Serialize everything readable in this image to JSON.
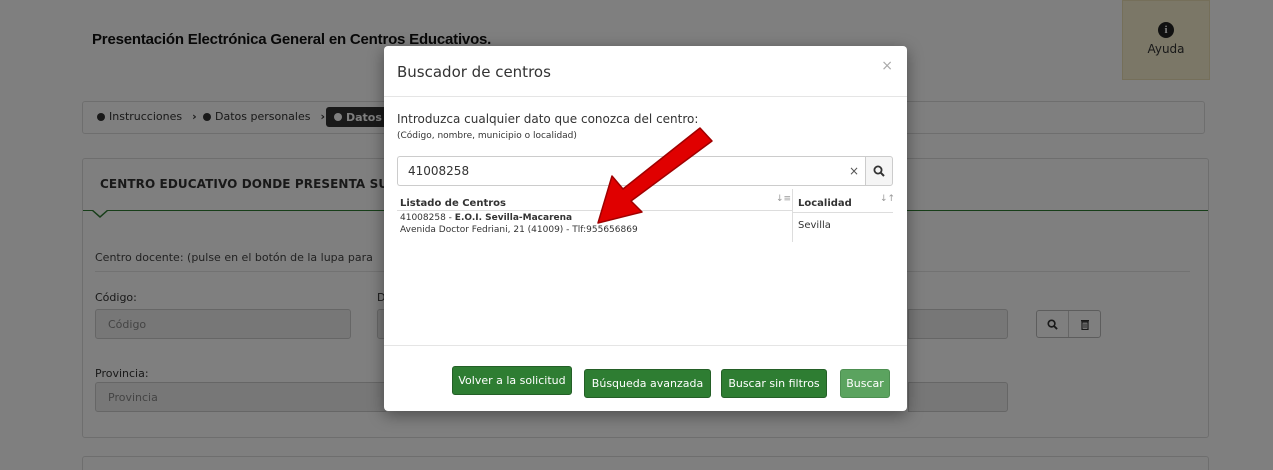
{
  "page": {
    "title": "Presentación Electrónica General en Centros Educativos.",
    "help_label": "Ayuda",
    "steps": [
      "Instrucciones",
      "Datos personales",
      "Datos"
    ],
    "panel_title": "CENTRO EDUCATIVO DONDE PRESENTA SU",
    "centro_text": "Centro docente: (pulse en el botón de la lupa para",
    "codigo_label": "Código:",
    "codigo_placeholder": "Código",
    "d_label": "D",
    "provincia_label": "Provincia:",
    "provincia_placeholder": "Provincia"
  },
  "modal": {
    "title": "Buscador de centros",
    "close": "×",
    "intro": "Introduzca cualquier dato que conozca del centro:",
    "intro_sub": "(Código, nombre, municipio o localidad)",
    "search_value": "41008258",
    "search_clear": "×",
    "results": {
      "col_nombre": "Listado de Centros",
      "col_localidad": "Localidad",
      "rows": [
        {
          "code": "41008258",
          "name": "E.O.I. Sevilla-Macarena",
          "address": "Avenida Doctor Fedriani, 21 (41009) - Tlf:955656869",
          "localidad": "Sevilla"
        }
      ]
    },
    "buttons": {
      "volver": "Volver a la solicitud",
      "avanzada": "Búsqueda avanzada",
      "sin_filtros": "Buscar sin filtros",
      "buscar": "Buscar"
    }
  },
  "colors": {
    "primary_green": "#2e7d32",
    "light_green": "#5ba35f",
    "arrow_red": "#e00000",
    "help_bg": "#f6efcf"
  },
  "icons": {
    "help": "info-circle-icon",
    "search": "search-icon",
    "trash": "trash-icon",
    "close": "close-icon",
    "sort": "sort-icon",
    "arrow": "red-arrow-icon"
  }
}
